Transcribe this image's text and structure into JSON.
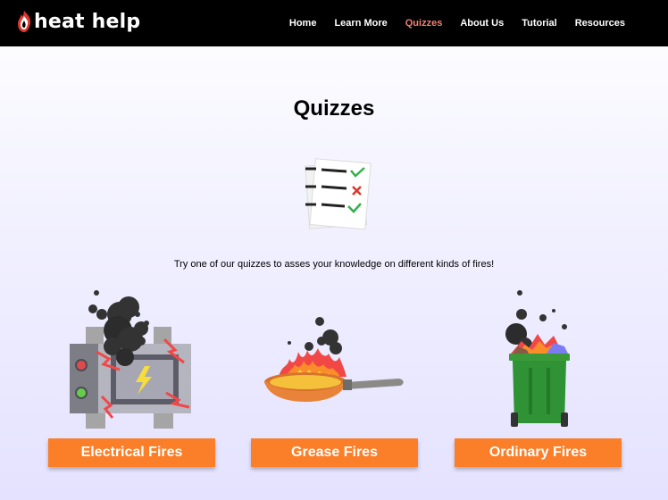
{
  "brand": {
    "name": "heat help"
  },
  "nav": {
    "items": [
      {
        "label": "Home",
        "active": false
      },
      {
        "label": "Learn More",
        "active": false
      },
      {
        "label": "Quizzes",
        "active": true
      },
      {
        "label": "About Us",
        "active": false
      },
      {
        "label": "Tutorial",
        "active": false
      },
      {
        "label": "Resources",
        "active": false
      }
    ]
  },
  "main": {
    "title": "Quizzes",
    "tagline": "Try one of our quizzes to asses your knowledge on different kinds of fires!",
    "quizzes": [
      {
        "label": "Electrical Fires",
        "icon": "electrical-fire-icon"
      },
      {
        "label": "Grease Fires",
        "icon": "grease-fire-icon"
      },
      {
        "label": "Ordinary Fires",
        "icon": "ordinary-fire-icon"
      }
    ]
  },
  "colors": {
    "nav_bg": "#000000",
    "nav_active": "#f07f73",
    "button": "#fb7e28"
  }
}
